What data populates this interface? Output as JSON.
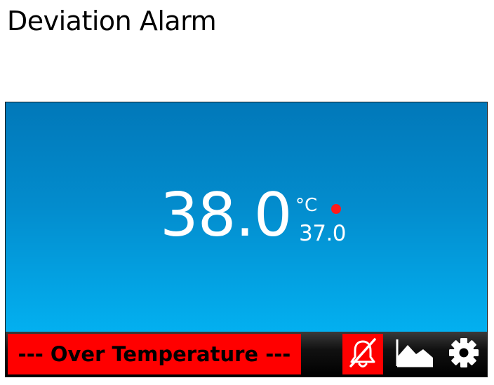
{
  "page": {
    "title": "Deviation Alarm"
  },
  "display": {
    "temperature": "38.0",
    "unit": "°C",
    "setpoint": "37.0",
    "indicator_color": "#ff1a1a"
  },
  "alarm": {
    "message": "--- Over Temperature ---",
    "color": "#ff0000"
  },
  "toolbar": {
    "buttons": [
      {
        "icon": "alarm-mute-icon"
      },
      {
        "icon": "trend-graph-icon"
      },
      {
        "icon": "settings-gear-icon"
      }
    ]
  }
}
